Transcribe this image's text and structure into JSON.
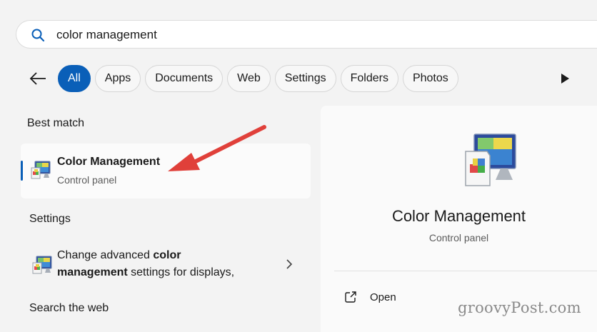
{
  "search": {
    "query": "color management"
  },
  "filters": [
    "All",
    "Apps",
    "Documents",
    "Web",
    "Settings",
    "Folders",
    "Photos"
  ],
  "sections": {
    "best_match": "Best match",
    "settings": "Settings",
    "search_web": "Search the web"
  },
  "best_match_item": {
    "title": "Color Management",
    "subtitle": "Control panel"
  },
  "settings_item": {
    "text_1": "Change advanced ",
    "bold_1": "color",
    "bold_2": "management",
    "text_2": " settings for displays,"
  },
  "preview": {
    "title": "Color Management",
    "subtitle": "Control panel",
    "open_label": "Open"
  },
  "watermark": "groovyPost.com",
  "colors": {
    "accent": "#0a5fb8",
    "annotation_arrow": "#e0403a"
  }
}
